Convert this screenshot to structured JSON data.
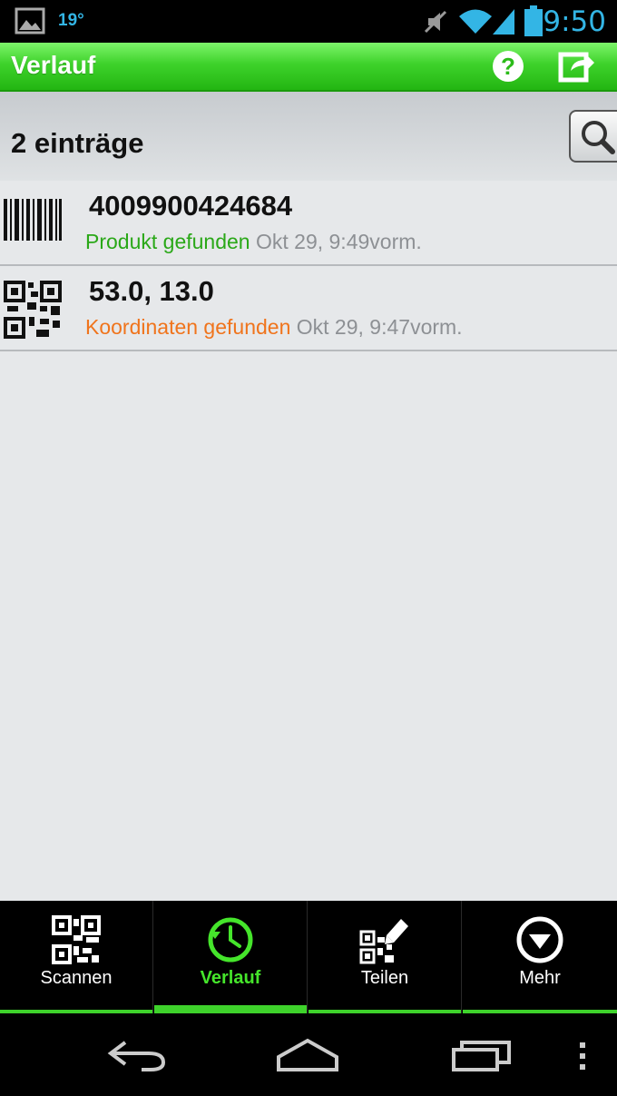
{
  "status_bar": {
    "temperature": "19°",
    "time": "9:50",
    "icons": [
      "gallery-icon",
      "mute-icon",
      "wifi-icon",
      "signal-icon",
      "battery-icon"
    ]
  },
  "action_bar": {
    "title": "Verlauf",
    "help_icon": "help-icon",
    "export_icon": "export-icon",
    "accent": "#3ed22b"
  },
  "list_header": {
    "count_text": "2 einträge",
    "search_icon": "search-icon"
  },
  "history": [
    {
      "type_icon": "barcode-icon",
      "value": "4009900424684",
      "status": "Produkt gefunden",
      "status_color": "#2aa818",
      "timestamp": "Okt 29, 9:49vorm."
    },
    {
      "type_icon": "qr-code-icon",
      "value": "53.0, 13.0",
      "status": "Koordinaten gefunden",
      "status_color": "#f0741c",
      "timestamp": "Okt 29, 9:47vorm."
    }
  ],
  "bottom_nav": {
    "items": [
      {
        "label": "Scannen",
        "icon": "qr-scan-icon",
        "active": false
      },
      {
        "label": "Verlauf",
        "icon": "history-clock-icon",
        "active": true
      },
      {
        "label": "Teilen",
        "icon": "qr-edit-icon",
        "active": false
      },
      {
        "label": "Mehr",
        "icon": "more-down-icon",
        "active": false
      }
    ]
  },
  "system_nav": [
    "back-icon",
    "home-icon",
    "recents-icon",
    "overflow-menu-icon"
  ]
}
